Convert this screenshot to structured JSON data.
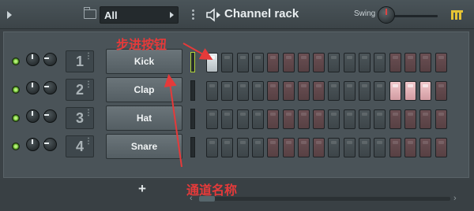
{
  "toolbar": {
    "filter_value": "All",
    "title": "Channel rack",
    "swing_label": "Swing"
  },
  "channels": [
    {
      "number": "1",
      "name": "Kick",
      "selected": true,
      "steps": [
        1,
        0,
        0,
        0,
        0,
        0,
        0,
        0,
        0,
        0,
        0,
        0,
        0,
        0,
        0,
        0
      ]
    },
    {
      "number": "2",
      "name": "Clap",
      "selected": false,
      "steps": [
        0,
        0,
        0,
        0,
        0,
        0,
        0,
        0,
        0,
        0,
        0,
        0,
        1,
        1,
        1,
        0
      ]
    },
    {
      "number": "3",
      "name": "Hat",
      "selected": false,
      "steps": [
        0,
        0,
        0,
        0,
        0,
        0,
        0,
        0,
        0,
        0,
        0,
        0,
        0,
        0,
        0,
        0
      ]
    },
    {
      "number": "4",
      "name": "Snare",
      "selected": false,
      "steps": [
        0,
        0,
        0,
        0,
        0,
        0,
        0,
        0,
        0,
        0,
        0,
        0,
        0,
        0,
        0,
        0
      ]
    }
  ],
  "bottom": {
    "add_label": "+"
  },
  "annotations": {
    "step_buttons": "步进按钮",
    "channel_name": "通道名称"
  },
  "colors": {
    "accent_red_annotation": "#e53a3a",
    "led_green": "#5fae2a",
    "step_group_grey": "#4c5559",
    "step_group_red": "#6a4f53"
  }
}
